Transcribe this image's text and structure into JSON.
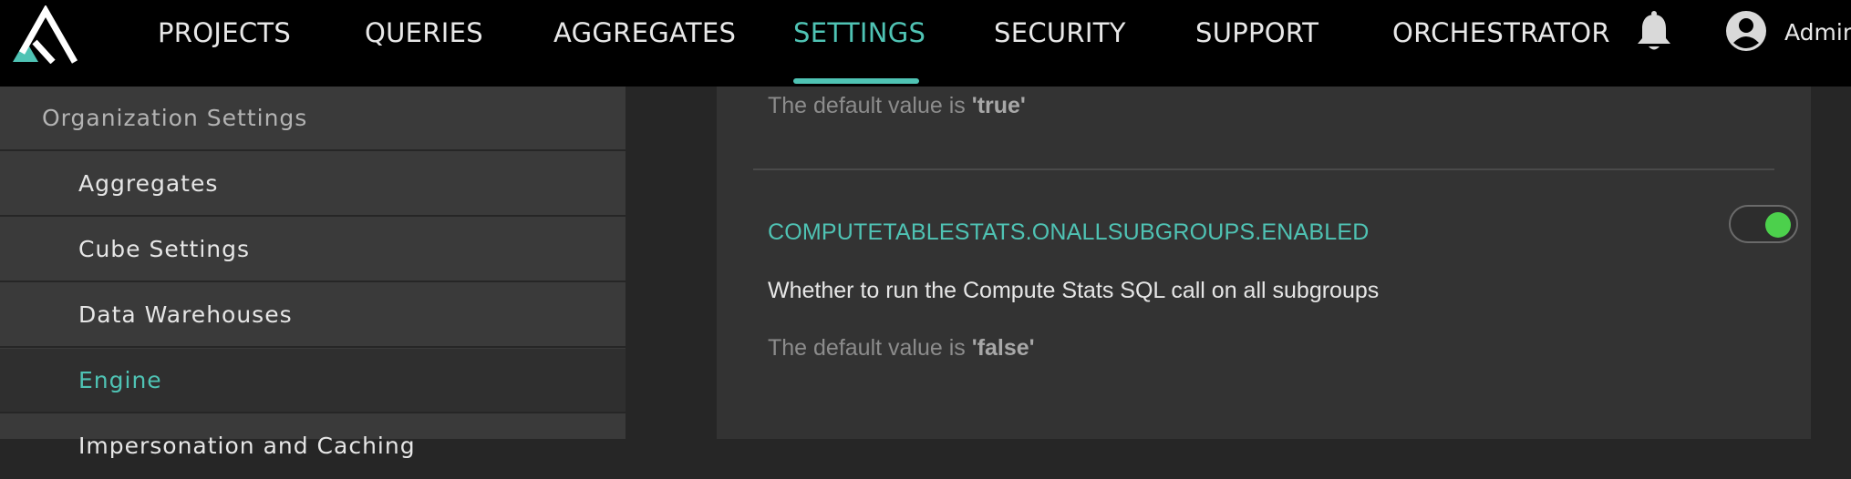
{
  "nav": {
    "items": [
      {
        "label": "PROJECTS"
      },
      {
        "label": "QUERIES"
      },
      {
        "label": "AGGREGATES"
      },
      {
        "label": "SETTINGS"
      },
      {
        "label": "SECURITY"
      },
      {
        "label": "SUPPORT"
      },
      {
        "label": "ORCHESTRATOR"
      }
    ],
    "active": "SETTINGS",
    "user": "Admin",
    "icons": [
      "logo-icon",
      "bell-icon",
      "user-avatar-icon"
    ]
  },
  "sidebar": {
    "header": "Organization Settings",
    "items": [
      {
        "label": "Aggregates"
      },
      {
        "label": "Cube Settings"
      },
      {
        "label": "Data Warehouses"
      },
      {
        "label": "Engine"
      },
      {
        "label": "Impersonation and Caching"
      }
    ],
    "active": "Engine"
  },
  "main": {
    "prev_default_prefix": "The default value is ",
    "prev_default_value": "'true'",
    "setting": {
      "key": "COMPUTETABLESTATS.ONALLSUBGROUPS.ENABLED",
      "description": "Whether to run the Compute Stats SQL call on all subgroups",
      "default_prefix": "The default value is ",
      "default_value": "'false'",
      "enabled": true
    }
  },
  "colors": {
    "accent": "#4fc3b4",
    "toggle_on": "#4cd04c",
    "topbar": "#000000",
    "sidebar": "#3a3a3a",
    "panel": "#333333"
  }
}
